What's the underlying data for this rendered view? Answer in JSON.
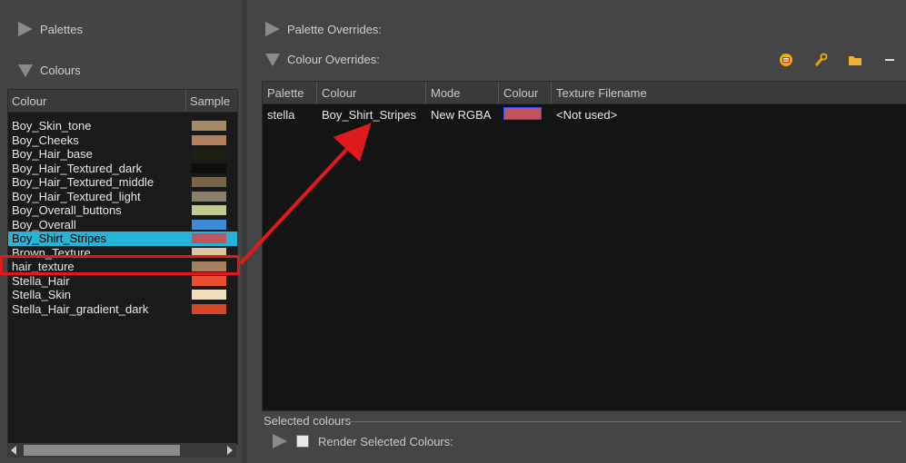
{
  "left": {
    "palettes_label": "Palettes",
    "colours_label": "Colours",
    "list_headers": {
      "colour": "Colour",
      "sample": "Sample"
    },
    "items": [
      {
        "name": "Boy_Skin_tone",
        "color": "#a58a68"
      },
      {
        "name": "Boy_Cheeks",
        "color": "#b28060"
      },
      {
        "name": "Boy_Hair_base",
        "color": "#1f1f14"
      },
      {
        "name": "Boy_Hair_Textured_dark",
        "color": "#0e0e08"
      },
      {
        "name": "Boy_Hair_Textured_middle",
        "color": "#7a6448"
      },
      {
        "name": "Boy_Hair_Textured_light",
        "color": "#8a7f68"
      },
      {
        "name": "Boy_Overall_buttons",
        "color": "#c4c994"
      },
      {
        "name": "Boy_Overall",
        "color": "#3b8bd8"
      },
      {
        "name": "Boy_Shirt_Stripes",
        "color": "#c1545c"
      },
      {
        "name": "Brown_Texture",
        "color": "#d8c9a0"
      },
      {
        "name": "hair_texture",
        "color": "#a58060"
      },
      {
        "name": "Stella_Hair",
        "color": "#e85030"
      },
      {
        "name": "Stella_Skin",
        "color": "#f4dfbc"
      },
      {
        "name": "Stella_Hair_gradient_dark",
        "color": "#d84628"
      }
    ],
    "selected_index": 8
  },
  "right": {
    "palette_overrides_label": "Palette Overrides:",
    "colour_overrides_label": "Colour Overrides:",
    "toolbar_icons": [
      "color-picker-icon",
      "wrench-icon",
      "folder-icon",
      "minus-icon"
    ],
    "table_headers": [
      "Palette",
      "Colour",
      "Mode",
      "Colour",
      "Texture Filename"
    ],
    "rows": [
      {
        "palette": "stella",
        "colour": "Boy_Shirt_Stripes",
        "mode": "New RGBA",
        "swatch": "#c1545c",
        "texture": "<Not used>"
      }
    ],
    "selected_colours_label": "Selected colours",
    "render_selected_label": "Render Selected Colours:"
  },
  "annotation_color": "#e0191c"
}
